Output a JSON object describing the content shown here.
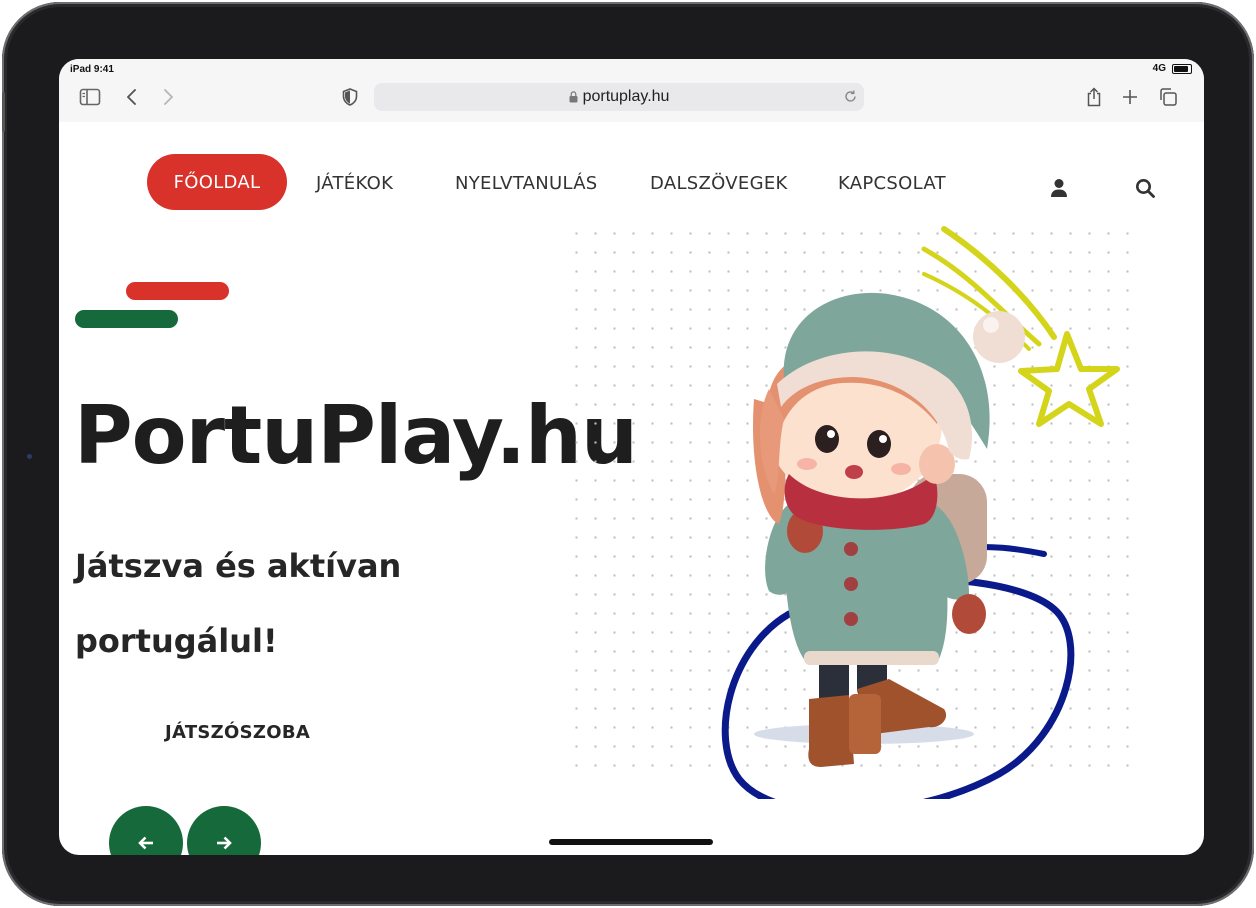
{
  "status": {
    "time": "iPad 9:41",
    "network": "4G"
  },
  "browser": {
    "url": "portuplay.hu"
  },
  "nav": {
    "items": [
      {
        "label": "FŐOLDAL",
        "active": true
      },
      {
        "label": "JÁTÉKOK"
      },
      {
        "label": "NYELVTANULÁS"
      },
      {
        "label": "DALSZÖVEGEK"
      },
      {
        "label": "KAPCSOLAT"
      }
    ],
    "icons": [
      "user-icon",
      "search-icon"
    ]
  },
  "hero": {
    "title": "PortuPlay.hu",
    "subtitle": "Játszva és aktívan portugálul!",
    "cta": "JÁTSZÓSZOBA"
  },
  "carousel": {
    "prev": "arrow-left-icon",
    "next": "arrow-right-icon"
  },
  "colors": {
    "red": "#d8322a",
    "green": "#16693a",
    "star": "#d4d41a",
    "circle": "#0a1a8a"
  }
}
